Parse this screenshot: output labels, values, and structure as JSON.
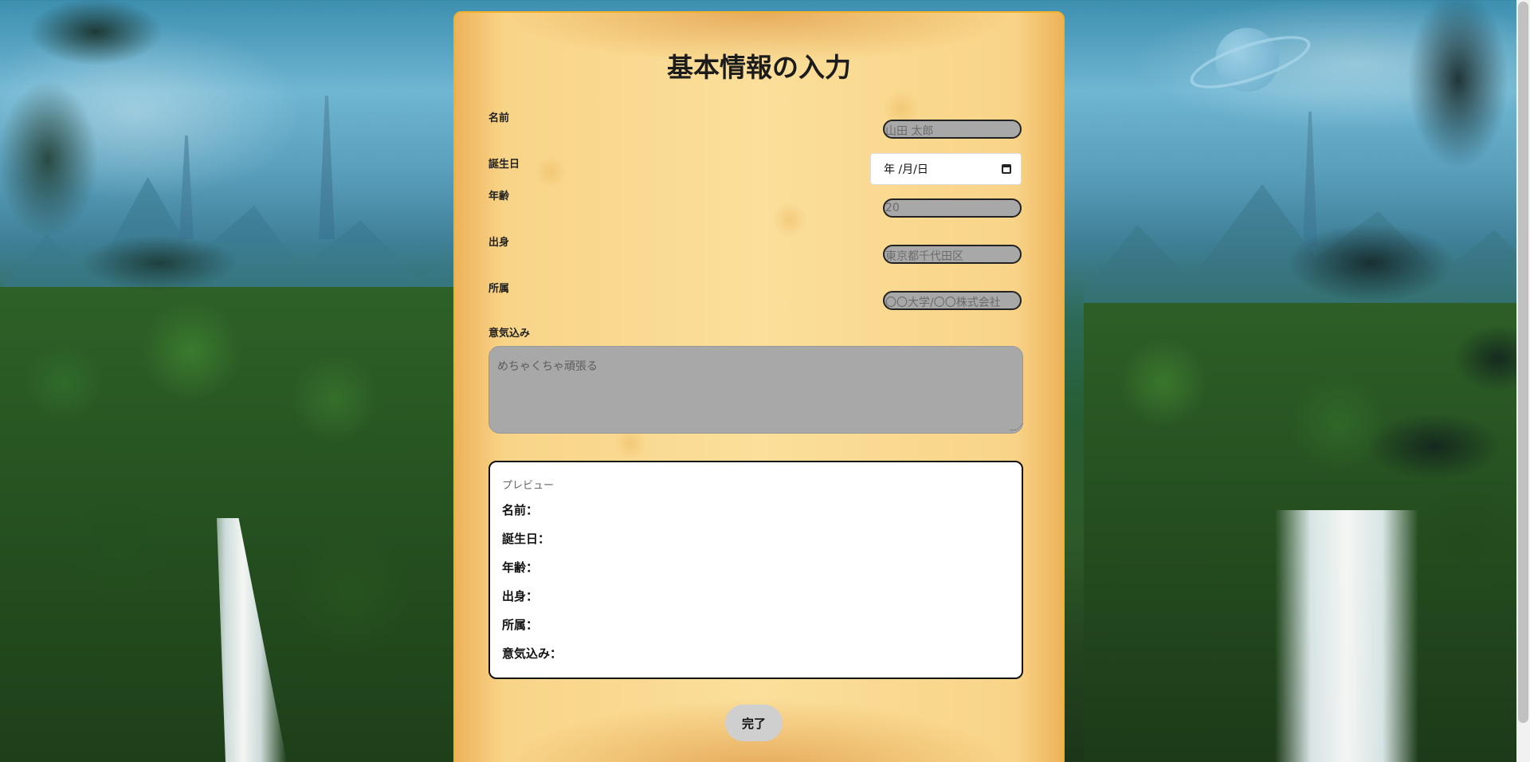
{
  "form": {
    "title": "基本情報の入力",
    "fields": {
      "name": {
        "label": "名前",
        "placeholder": "山田 太郎"
      },
      "birthday": {
        "label": "誕生日",
        "value": "年 /月/日"
      },
      "age": {
        "label": "年齢",
        "placeholder": "20"
      },
      "hometown": {
        "label": "出身",
        "placeholder": "東京都千代田区"
      },
      "affiliation": {
        "label": "所属",
        "placeholder": "〇〇大学/〇〇株式会社"
      },
      "motivation": {
        "label": "意気込み",
        "placeholder": "めちゃくちゃ頑張る"
      }
    },
    "preview": {
      "title": "プレビュー",
      "rows": [
        "名前：",
        "誕生日：",
        "年齢：",
        "出身：",
        "所属：",
        "意気込み："
      ]
    },
    "submit_label": "完了"
  }
}
